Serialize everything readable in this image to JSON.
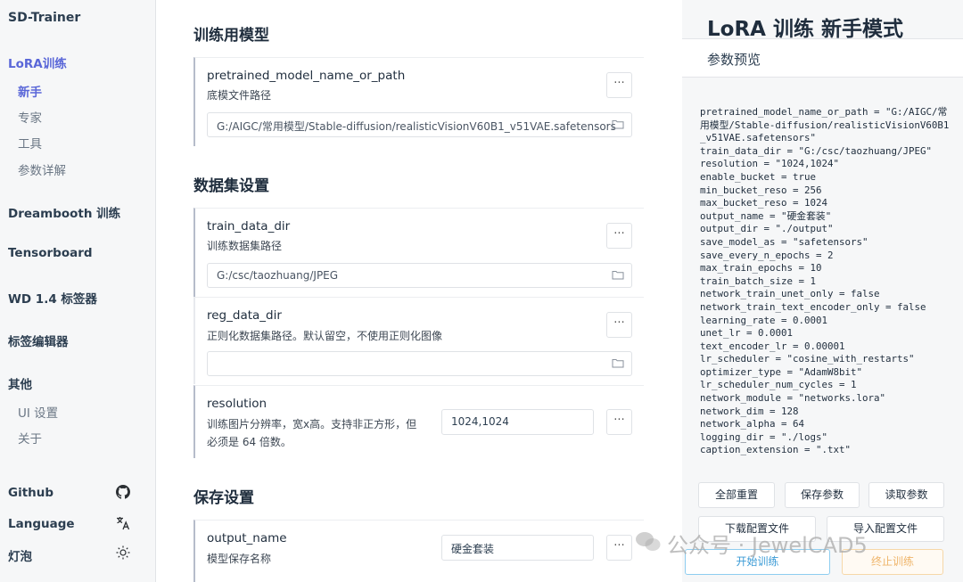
{
  "sidebar": {
    "app_title": "SD-Trainer",
    "lora_group": "LoRA训练",
    "lora_items": [
      "新手",
      "专家",
      "工具",
      "参数详解"
    ],
    "dreambooth": "Dreambooth 训练",
    "tensorboard": "Tensorboard",
    "tagger": "WD 1.4 标签器",
    "tag_editor": "标签编辑器",
    "other_group": "其他",
    "other_items": [
      "UI 设置",
      "关于"
    ],
    "github": "Github",
    "language": "Language",
    "bulb": "灯泡"
  },
  "main": {
    "section_model": "训练用模型",
    "pretrained": {
      "name": "pretrained_model_name_or_path",
      "desc": "底模文件路径",
      "value": "G:/AIGC/常用模型/Stable-diffusion/realisticVisionV60B1_v51VAE.safetensors"
    },
    "section_dataset": "数据集设置",
    "train_data_dir": {
      "name": "train_data_dir",
      "desc": "训练数据集路径",
      "value": "G:/csc/taozhuang/JPEG"
    },
    "reg_data_dir": {
      "name": "reg_data_dir",
      "desc": "正则化数据集路径。默认留空，不使用正则化图像",
      "value": ""
    },
    "resolution": {
      "name": "resolution",
      "desc_line1": "训练图片分辨率，宽x高。支持非正方形，但",
      "desc_line2": "必须是 64 倍数。",
      "value": "1024,1024"
    },
    "section_save": "保存设置",
    "output_name": {
      "name": "output_name",
      "desc": "模型保存名称",
      "value": "硬金套装"
    },
    "more_label": "···"
  },
  "preview": {
    "title": "LoRA 训练 新手模式",
    "subtitle": "参数预览",
    "code": "pretrained_model_name_or_path = \"G:/AIGC/常用模型/Stable-diffusion/realisticVisionV60B1_v51VAE.safetensors\"\ntrain_data_dir = \"G:/csc/taozhuang/JPEG\"\nresolution = \"1024,1024\"\nenable_bucket = true\nmin_bucket_reso = 256\nmax_bucket_reso = 1024\noutput_name = \"硬金套装\"\noutput_dir = \"./output\"\nsave_model_as = \"safetensors\"\nsave_every_n_epochs = 2\nmax_train_epochs = 10\ntrain_batch_size = 1\nnetwork_train_unet_only = false\nnetwork_train_text_encoder_only = false\nlearning_rate = 0.0001\nunet_lr = 0.0001\ntext_encoder_lr = 0.00001\nlr_scheduler = \"cosine_with_restarts\"\noptimizer_type = \"AdamW8bit\"\nlr_scheduler_num_cycles = 1\nnetwork_module = \"networks.lora\"\nnetwork_dim = 128\nnetwork_alpha = 64\nlogging_dir = \"./logs\"\ncaption_extension = \".txt\"",
    "buttons": {
      "reset_all": "全部重置",
      "save_params": "保存参数",
      "load_params": "读取参数",
      "download_config": "下载配置文件",
      "import_config": "导入配置文件",
      "start_training": "开始训练",
      "stop_training": "终止训练"
    }
  },
  "watermark": "公众号 · JewelCAD5",
  "colors": {
    "accent": "#5a67d8",
    "start": "#3b9bd6",
    "stop": "#efb56b"
  }
}
